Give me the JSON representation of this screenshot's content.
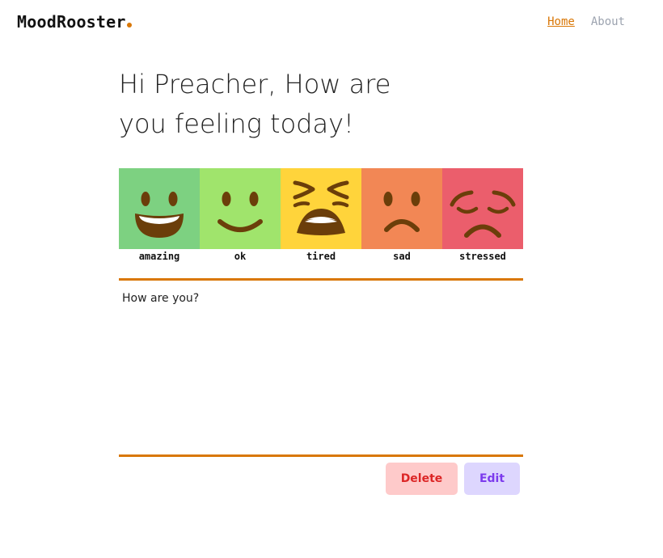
{
  "app": {
    "name": "MoodRooster",
    "accent_color": "#d97706"
  },
  "nav": {
    "items": [
      {
        "label": "Home",
        "active": true,
        "color": "#d97706"
      },
      {
        "label": "About",
        "active": false,
        "color": "#9ca3af"
      }
    ]
  },
  "heading": "Hi Preacher, How are you feeling today!",
  "moods": [
    {
      "label": "amazing",
      "color": "#7dd181",
      "icon": "grinning-face-icon"
    },
    {
      "label": "ok",
      "color": "#a0e46c",
      "icon": "smiling-face-icon"
    },
    {
      "label": "tired",
      "color": "#ffd43b",
      "icon": "tired-face-icon"
    },
    {
      "label": "sad",
      "color": "#f28755",
      "icon": "frowning-face-icon"
    },
    {
      "label": "stressed",
      "color": "#eb5e6c",
      "icon": "pensive-face-icon"
    }
  ],
  "entry": {
    "text": "How are you?",
    "border_color": "#d97706"
  },
  "actions": {
    "delete_label": "Delete",
    "delete_bg": "#fecaca",
    "delete_color": "#dc2626",
    "edit_label": "Edit",
    "edit_bg": "#ddd6fe",
    "edit_color": "#7c3aed"
  },
  "face_color": "#6b3e0a"
}
